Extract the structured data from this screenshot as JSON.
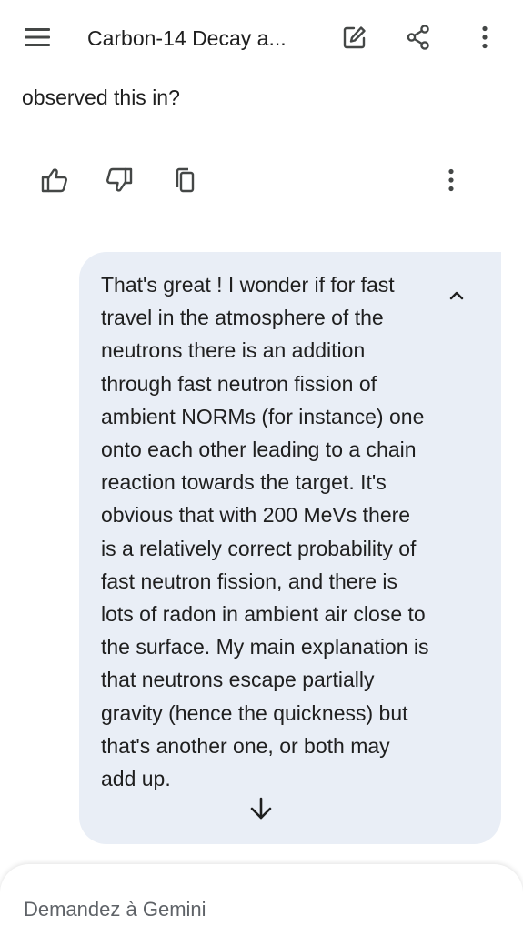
{
  "header": {
    "title": "Carbon-14 Decay a...",
    "icons": {
      "menu": "menu-icon",
      "edit": "edit-icon",
      "share": "share-icon",
      "more": "more-vert-icon"
    }
  },
  "previous_response": {
    "text_fragment": "observed this in?",
    "actions": {
      "thumb_up": "thumb-up-icon",
      "thumb_down": "thumb-down-icon",
      "copy": "copy-icon",
      "more": "more-vert-icon"
    }
  },
  "user_message": {
    "text": "That's great ! I wonder if for fast travel in the atmosphere of the neutrons there is an addition through fast neutron fission of ambient NORMs (for instance) one onto each other leading to a chain reaction towards the target. It's obvious that with 200 MeVs there is a relatively correct probability of fast neutron fission, and there is lots of radon in ambient air close to the surface. My main explanation is that neutrons escape partially gravity (hence the quickness) but that's another one, or both may add up.",
    "collapse_icon": "chevron-up-icon",
    "bubble_color": "#e9eef6"
  },
  "scroll_down_icon": "arrow-down-icon",
  "input": {
    "placeholder": "Demandez à Gemini",
    "value": ""
  },
  "colors": {
    "text": "#1f1f1f",
    "placeholder": "#5f6368",
    "background": "#ffffff"
  }
}
